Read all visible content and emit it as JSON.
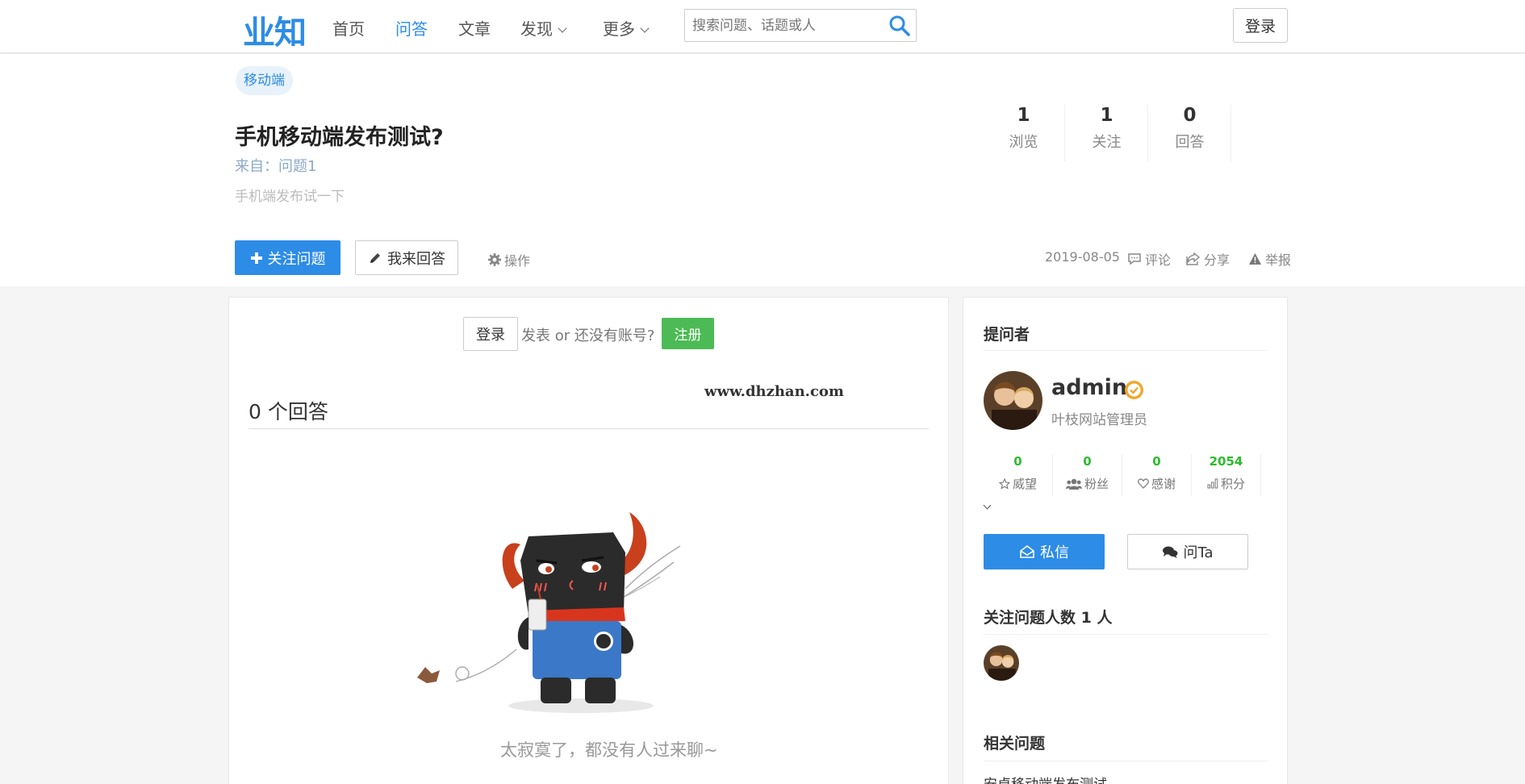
{
  "nav": {
    "logo": "业知",
    "links": [
      {
        "label": "首页"
      },
      {
        "label": "问答"
      },
      {
        "label": "文章"
      },
      {
        "label": "发现"
      },
      {
        "label": "更多"
      }
    ],
    "search_placeholder": "搜索问题、话题或人",
    "login_label": "登录"
  },
  "question": {
    "tag": "移动端",
    "title": "手机移动端发布测试?",
    "from": "来自：问题1",
    "description": "手机端发布试一下",
    "stats": [
      {
        "value": "1",
        "label": "浏览"
      },
      {
        "value": "1",
        "label": "关注"
      },
      {
        "value": "0",
        "label": "回答"
      }
    ],
    "follow_label": "关注问题",
    "answer_label": "我来回答",
    "ops_label": "操作",
    "date": "2019-08-05",
    "comment_label": "评论",
    "share_label": "分享",
    "report_label": "举报"
  },
  "main": {
    "login_label": "登录",
    "prompt": "发表 or 还没有账号?",
    "register_label": "注册",
    "watermark": "www.dhzhan.com",
    "answer_count": "0 个回答",
    "empty_text": "太寂寞了，都没有人过来聊~"
  },
  "sidebar": {
    "asker_heading": "提问者",
    "user": {
      "name": "admin",
      "role": "叶枝网站管理员"
    },
    "user_stats": [
      {
        "value": "0",
        "label": "威望",
        "icon": "star-icon"
      },
      {
        "value": "0",
        "label": "粉丝",
        "icon": "users-icon"
      },
      {
        "value": "0",
        "label": "感谢",
        "icon": "heart-icon"
      },
      {
        "value": "2054",
        "label": "积分",
        "icon": "bar-chart-icon"
      }
    ],
    "pm_label": "私信",
    "ask_label": "问Ta",
    "followers_heading": "关注问题人数 1 人",
    "related_heading": "相关问题",
    "related_items": [
      "安卓移动端发布测试"
    ]
  },
  "colors": {
    "accent": "#2d8ce6",
    "success": "#4cbb55",
    "stat_green": "#2dbb2d"
  }
}
